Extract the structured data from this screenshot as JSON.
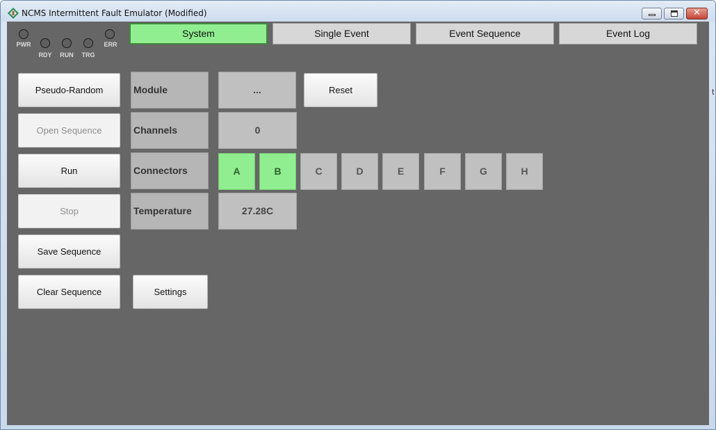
{
  "window": {
    "title": "NCMS Intermittent Fault Emulator  (Modified)",
    "close_glyph": "✕"
  },
  "leds": [
    {
      "label": "PWR",
      "color": "#5f5f5f"
    },
    {
      "label": "RDY",
      "color": "#5f5f5f"
    },
    {
      "label": "RUN",
      "color": "#5f5f5f"
    },
    {
      "label": "TRG",
      "color": "#5f5f5f"
    },
    {
      "label": "ERR",
      "color": "#5f5f5f"
    }
  ],
  "tabs": [
    {
      "label": "System",
      "active": true
    },
    {
      "label": "Single Event",
      "active": false
    },
    {
      "label": "Event Sequence",
      "active": false
    },
    {
      "label": "Event Log",
      "active": false
    }
  ],
  "side_buttons": [
    {
      "label": "Pseudo-Random",
      "enabled": true
    },
    {
      "label": "Open Sequence",
      "enabled": false
    },
    {
      "label": "Run",
      "enabled": true
    },
    {
      "label": "Stop",
      "enabled": false
    },
    {
      "label": "Save Sequence",
      "enabled": true
    },
    {
      "label": "Clear Sequence",
      "enabled": true
    }
  ],
  "fields": {
    "module": {
      "label": "Module",
      "value": "..."
    },
    "channels": {
      "label": "Channels",
      "value": "0"
    },
    "connectors": {
      "label": "Connectors"
    },
    "temperature": {
      "label": "Temperature",
      "value": "27.28C"
    }
  },
  "connectors": [
    {
      "letter": "A",
      "selected": true
    },
    {
      "letter": "B",
      "selected": true
    },
    {
      "letter": "C",
      "selected": false
    },
    {
      "letter": "D",
      "selected": false
    },
    {
      "letter": "E",
      "selected": false
    },
    {
      "letter": "F",
      "selected": false
    },
    {
      "letter": "G",
      "selected": false
    },
    {
      "letter": "H",
      "selected": false
    }
  ],
  "actions": {
    "reset_label": "Reset",
    "settings_label": "Settings"
  },
  "colors": {
    "background": "#666666",
    "active_green": "#90ee90"
  },
  "edge_artifact": "t"
}
